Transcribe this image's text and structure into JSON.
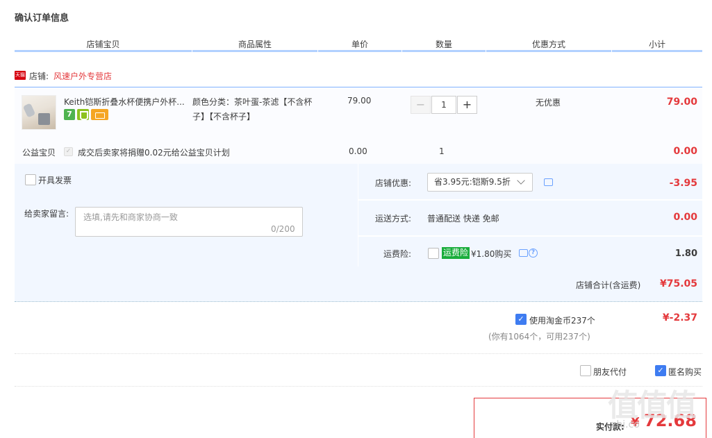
{
  "page_title": "确认订单信息",
  "columns": [
    "店铺宝贝",
    "商品属性",
    "单价",
    "数量",
    "优惠方式",
    "小计"
  ],
  "shop": {
    "badge": "天猫",
    "prefix": "店铺:",
    "name": "风速户外专营店"
  },
  "item": {
    "title": "Keith铠斯折叠水杯便携户外杯...",
    "badge_7": "7",
    "attr_line1": "颜色分类：茶叶蛋-茶滤【不含杯",
    "attr_line2": "子】【不含杯子】",
    "unit_price": "79.00",
    "qty_minus": "−",
    "quantity": "1",
    "qty_plus": "+",
    "discount": "无优惠",
    "subtotal": "79.00"
  },
  "charity": {
    "label": "公益宝贝",
    "text": "成交后卖家将捐赠0.02元给公益宝贝计划",
    "price": "0.00",
    "qty": "1",
    "subtotal": "0.00"
  },
  "invoice_label": "开具发票",
  "message": {
    "label": "给卖家留言:",
    "placeholder": "选填,请先和商家协商一致",
    "count": "0/200"
  },
  "shop_discount": {
    "label": "店铺优惠:",
    "selected": "省3.95元:铠斯9.5折",
    "amount": "-3.95"
  },
  "shipping": {
    "label": "运送方式:",
    "value": "普通配送 快递 免邮",
    "amount": "0.00"
  },
  "insurance": {
    "label": "运费险:",
    "badge": "运费险",
    "text": "¥1.80购买",
    "help": "?",
    "amount": "1.80"
  },
  "shop_total": {
    "label": "店铺合计(含运费)",
    "amount": "¥75.05"
  },
  "coins": {
    "label": "使用淘金币237个",
    "sub": "(你有1064个，可用237个)",
    "amount": "¥-2.37"
  },
  "friend_pay_label": "朋友代付",
  "anonymous_label": "匿名购买",
  "checkmark": "✓",
  "actual_pay": {
    "label": "实付款:",
    "currency": "¥",
    "amount": "72.68"
  },
  "watermark": {
    "logo": "值值值",
    "url": "zhi.co"
  }
}
